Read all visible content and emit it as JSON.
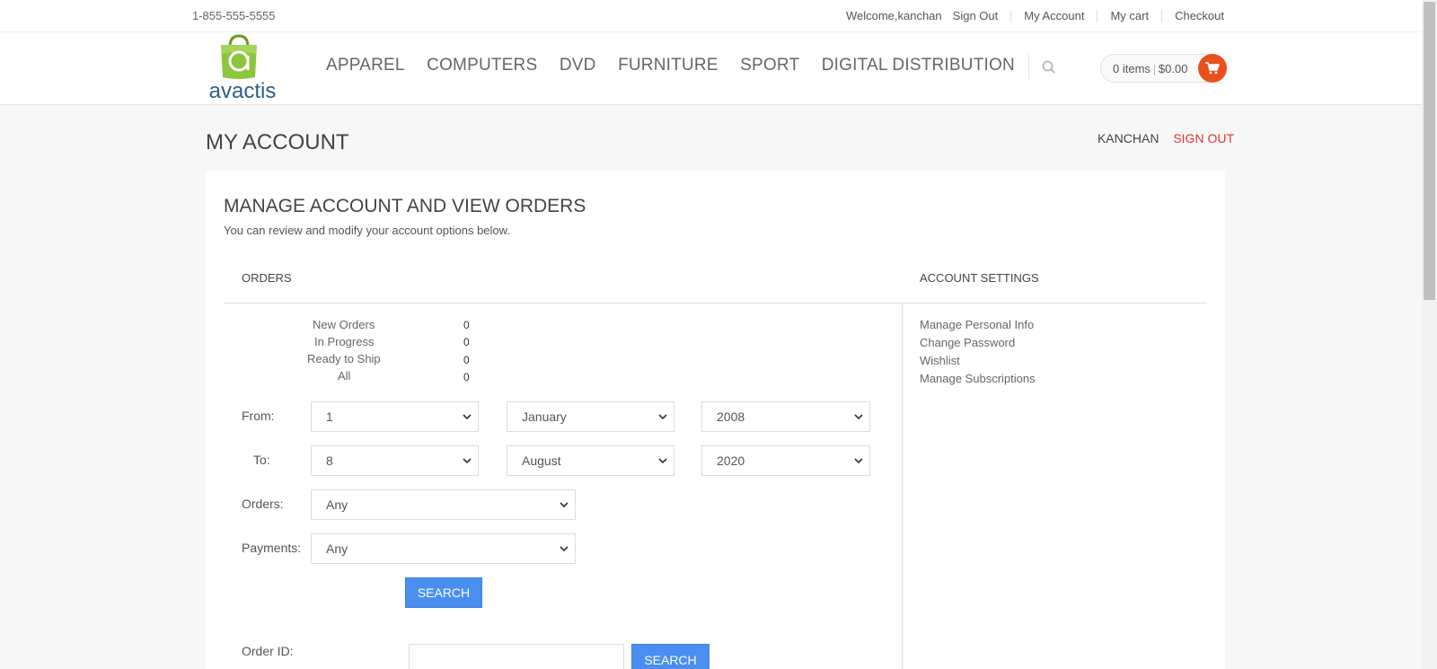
{
  "topbar": {
    "phone": "1-855-555-5555",
    "welcome": "Welcome,kanchan",
    "links": [
      "Sign Out",
      "My Account",
      "My cart",
      "Checkout"
    ]
  },
  "header": {
    "logo_text": "avactis",
    "nav": [
      "APPAREL",
      "COMPUTERS",
      "DVD",
      "FURNITURE",
      "SPORT",
      "DIGITAL DISTRIBUTION"
    ],
    "cart_items": "0 items",
    "cart_total": "$0.00"
  },
  "page": {
    "title": "MY ACCOUNT",
    "username": "KANCHAN",
    "signout": "SIGN OUT"
  },
  "panel": {
    "heading": "MANAGE ACCOUNT AND VIEW ORDERS",
    "subtitle": "You can review and modify your account options below.",
    "orders_header": "ORDERS",
    "settings_header": "ACCOUNT SETTINGS"
  },
  "order_stats": [
    {
      "label": "New Orders",
      "value": "0"
    },
    {
      "label": "In Progress",
      "value": "0"
    },
    {
      "label": "Ready to Ship",
      "value": "0"
    },
    {
      "label": "All",
      "value": "0"
    }
  ],
  "filters": {
    "from_label": "From:",
    "from_day": "1",
    "from_month": "January",
    "from_year": "2008",
    "to_label": "To:",
    "to_day": "8",
    "to_month": "August",
    "to_year": "2020",
    "orders_label": "Orders:",
    "orders_value": "Any",
    "payments_label": "Payments:",
    "payments_value": "Any",
    "search_label": "SEARCH",
    "order_id_label": "Order ID:",
    "order_id_value": "",
    "order_id_search_label": "SEARCH"
  },
  "account_settings": [
    "Manage Personal Info",
    "Change Password",
    "Wishlist",
    "Manage Subscriptions"
  ],
  "colors": {
    "accent_blue": "#4a8ff0",
    "signout_red": "#e0352b",
    "cart_orange": "#e8501f",
    "logo_green": "#8cc63f"
  }
}
